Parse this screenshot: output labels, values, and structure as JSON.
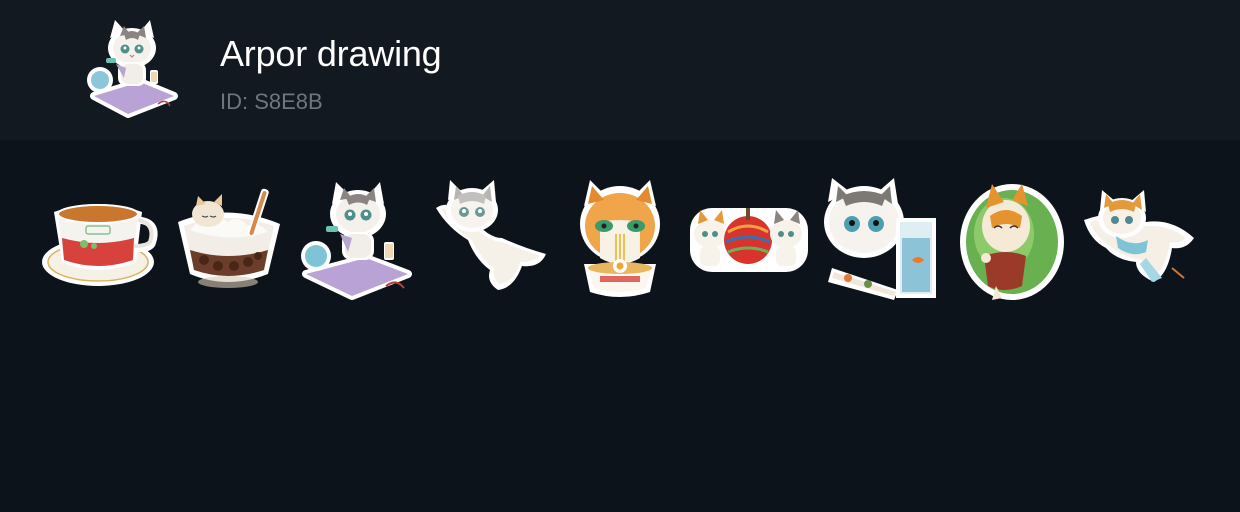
{
  "pack": {
    "title": "Arpor drawing",
    "id_text": "ID: S8E8B",
    "icon": "cat-yoga-sticker-icon"
  },
  "stickers": [
    {
      "name": "sticker-tea-cup",
      "icon": "tea-cup-sticker-icon"
    },
    {
      "name": "sticker-cat-pudding-bowl",
      "icon": "cat-pudding-sticker-icon"
    },
    {
      "name": "sticker-cat-yoga-mat",
      "icon": "cat-yoga-sticker-icon"
    },
    {
      "name": "sticker-cat-jumping",
      "icon": "cat-jumping-sticker-icon"
    },
    {
      "name": "sticker-cat-ramen",
      "icon": "cat-ramen-sticker-icon"
    },
    {
      "name": "sticker-cats-candy-apple",
      "icon": "cats-apple-sticker-icon"
    },
    {
      "name": "sticker-cat-fishbowl",
      "icon": "cat-fishbowl-sticker-icon"
    },
    {
      "name": "sticker-cat-lettuce-wrap",
      "icon": "cat-lettuce-sticker-icon"
    },
    {
      "name": "sticker-cat-scarf-dancing",
      "icon": "cat-scarf-sticker-icon"
    }
  ],
  "colors": {
    "page_background": "#0d131a",
    "header_background": "#121920",
    "title_text": "#ffffff",
    "id_text": "#6f767d"
  }
}
